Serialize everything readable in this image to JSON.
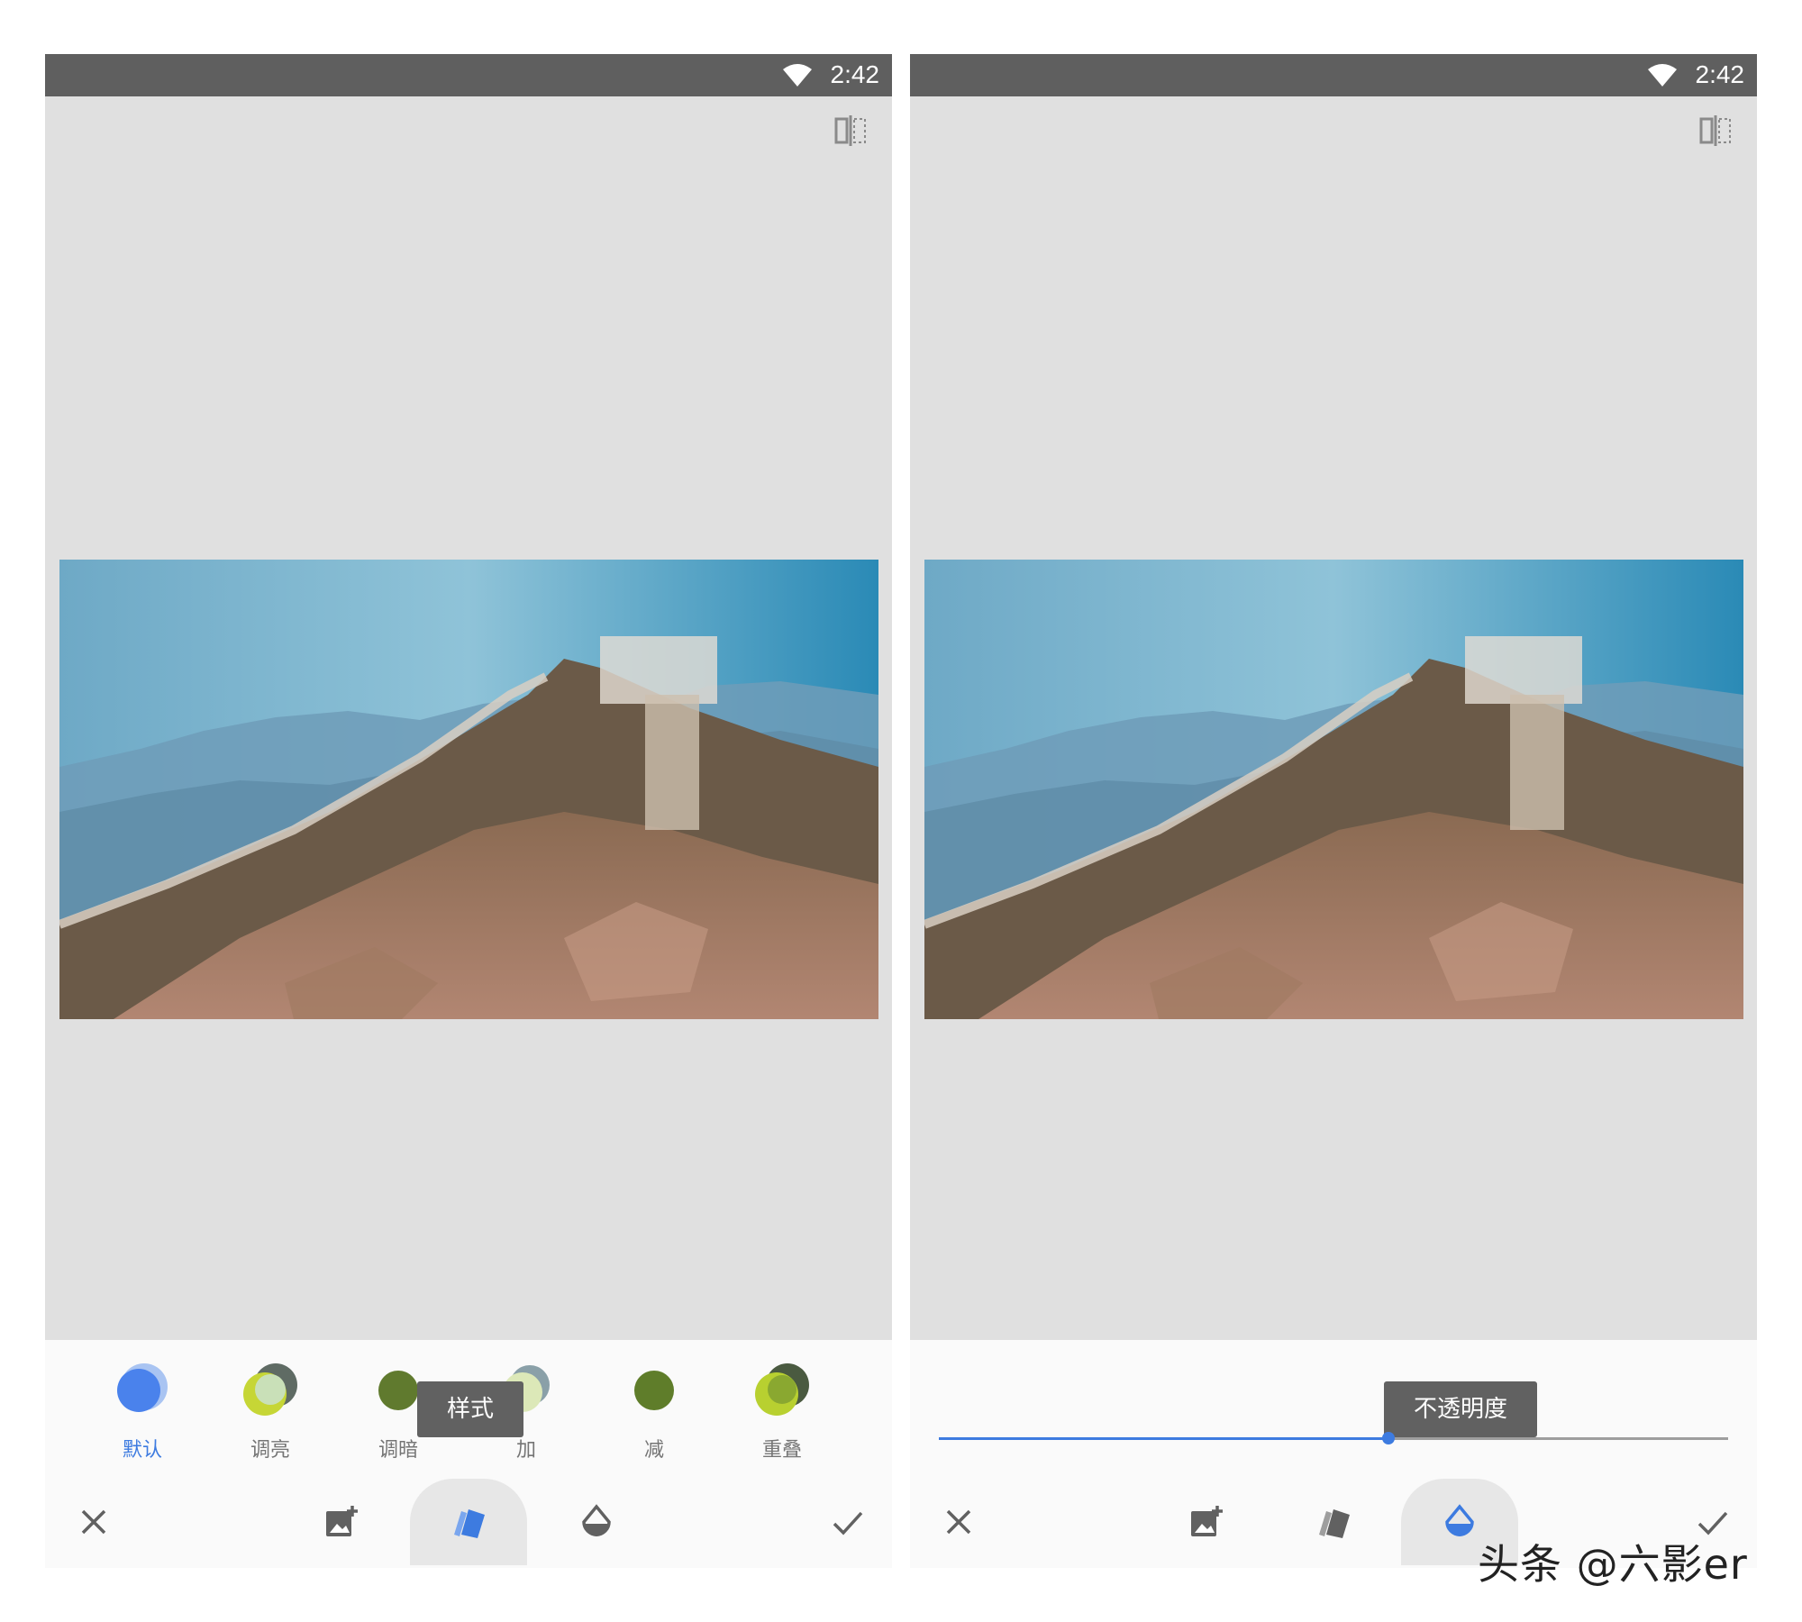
{
  "left_screen": {
    "status": {
      "time": "2:42"
    },
    "blend_modes": [
      {
        "label": "默认",
        "active": true
      },
      {
        "label": "调亮",
        "active": false
      },
      {
        "label": "调暗",
        "active": false
      },
      {
        "label": "加",
        "active": false
      },
      {
        "label": "减",
        "active": false
      },
      {
        "label": "重叠",
        "active": false
      }
    ],
    "tooltip": "样式",
    "toolbar": {
      "active_tool": "style",
      "tools": [
        "cancel-icon",
        "add-image-icon",
        "style-icon",
        "opacity-icon",
        "confirm-icon"
      ]
    }
  },
  "right_screen": {
    "status": {
      "time": "2:42"
    },
    "tooltip": "不透明度",
    "opacity_slider": {
      "value": 0.57
    },
    "toolbar": {
      "active_tool": "opacity",
      "tools": [
        "cancel-icon",
        "add-image-icon",
        "style-icon",
        "opacity-icon",
        "confirm-icon"
      ]
    }
  },
  "watermark": "头条 @六影er",
  "colors": {
    "accent": "#3d7be0",
    "status_bar": "#5f5f5f",
    "canvas_bg": "#e0e0e0",
    "tooltip_bg": "#616161"
  }
}
